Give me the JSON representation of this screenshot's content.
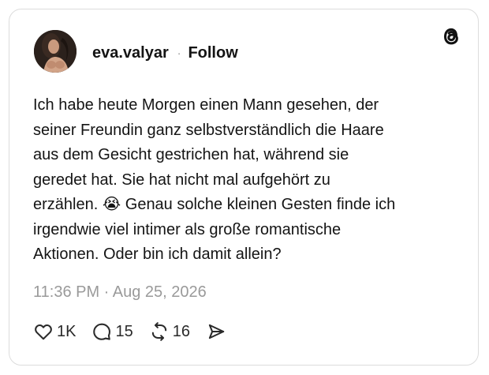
{
  "post": {
    "username": "eva.valyar",
    "separator": "·",
    "follow_label": "Follow",
    "text": "Ich habe heute Morgen einen Mann gesehen, der\nseiner Freundin ganz selbstverständlich die Haare\naus dem Gesicht gestrichen hat, während sie\ngeredet hat. Sie hat nicht mal aufgehört zu\nerzählen. 😭 Genau solche kleinen Gesten finde ich\nirgendwie viel intimer als große romantische\nAktionen. Oder bin ich damit allein?",
    "timestamp": "11:36 PM · Aug 25, 2026"
  },
  "actions": {
    "likes": "1K",
    "replies": "15",
    "reposts": "16"
  },
  "icons": {
    "logo": "threads-logo-icon",
    "like": "heart-icon",
    "reply": "comment-bubble-icon",
    "repost": "repost-icon",
    "share": "send-icon"
  },
  "colors": {
    "text": "#141414",
    "muted": "#9a9a9a",
    "border": "#dcdcdc"
  }
}
